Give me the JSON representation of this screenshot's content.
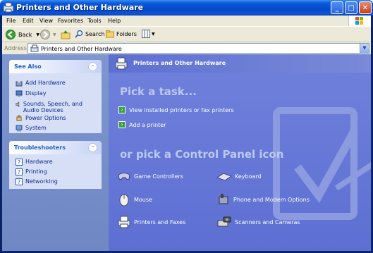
{
  "window": {
    "title": "Printers and Other Hardware"
  },
  "menu": [
    "File",
    "Edit",
    "View",
    "Favorites",
    "Tools",
    "Help"
  ],
  "toolbar": {
    "back": "Back",
    "search": "Search",
    "folders": "Folders"
  },
  "address": {
    "label": "Address",
    "value": "Printers and Other Hardware"
  },
  "see_also": {
    "title": "See Also",
    "items": [
      "Add Hardware",
      "Display",
      "Sounds, Speech, and Audio Devices",
      "Power Options",
      "System"
    ]
  },
  "troubleshooters": {
    "title": "Troubleshooters",
    "items": [
      "Hardware",
      "Printing",
      "Networking"
    ]
  },
  "main": {
    "header": "Printers and Other Hardware",
    "pick_task": "Pick a task...",
    "tasks": [
      "View installed printers or fax printers",
      "Add a printer"
    ],
    "pick_icon": "or pick a Control Panel icon",
    "icons": [
      "Game Controllers",
      "Keyboard",
      "Mouse",
      "Phone and Modem Options",
      "Printers and Faxes",
      "Scanners and Cameras"
    ]
  },
  "colors": {
    "titlebar": "#0a54d8",
    "left_pane": "#7f97cf",
    "right_pane": "#6375d6",
    "panel": "#d6dff5",
    "link": "#0c2b8e"
  }
}
